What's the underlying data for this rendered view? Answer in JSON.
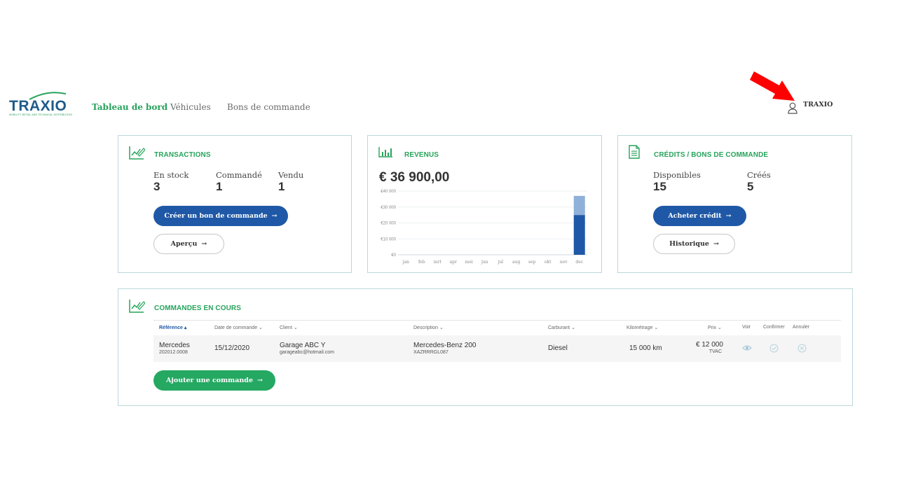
{
  "brand": {
    "name": "TRAXIO",
    "tagline": "MOBILITY RETAIL AND TECHNICAL DISTRIBUTION"
  },
  "nav": {
    "items": [
      {
        "label": "Tableau de bord",
        "active": true
      },
      {
        "label": "Véhicules",
        "active": false
      },
      {
        "label": "Bons de commande",
        "active": false
      }
    ]
  },
  "user": {
    "name": "TRAXIO",
    "icon": "user-icon",
    "annotation_color": "#ff0000"
  },
  "transactions": {
    "title": "TRANSACTIONS",
    "stats": [
      {
        "label": "En stock",
        "value": "3"
      },
      {
        "label": "Commandé",
        "value": "1"
      },
      {
        "label": "Vendu",
        "value": "1"
      }
    ],
    "primary_button": "Créer un bon de commande",
    "secondary_button": "Aperçu"
  },
  "revenue": {
    "title": "REVENUS",
    "amount": "€ 36 900,00"
  },
  "chart_data": {
    "type": "bar",
    "categories": [
      "jan",
      "feb",
      "mrt",
      "apr",
      "mei",
      "jun",
      "jul",
      "aug",
      "sep",
      "okt",
      "nov",
      "dec"
    ],
    "series": [
      {
        "values": [
          0,
          0,
          0,
          0,
          0,
          0,
          0,
          0,
          0,
          0,
          0,
          25000
        ],
        "color": "#1f58a6"
      },
      {
        "values": [
          0,
          0,
          0,
          0,
          0,
          0,
          0,
          0,
          0,
          0,
          0,
          12000
        ],
        "color": "#8fb0d8"
      }
    ],
    "ytick_labels": [
      "€0",
      "€10 000",
      "€20 000",
      "€30 000",
      "€40 000"
    ],
    "ytick_values": [
      0,
      10000,
      20000,
      30000,
      40000
    ],
    "ylim": [
      0,
      40000
    ],
    "stacked": true,
    "grid": true
  },
  "credits": {
    "title": "CRÉDITS / BONS DE COMMANDE",
    "stats": [
      {
        "label": "Disponibles",
        "value": "15"
      },
      {
        "label": "Créés",
        "value": "5"
      }
    ],
    "primary_button": "Acheter crédit",
    "secondary_button": "Historique"
  },
  "orders": {
    "title": "COMMANDES EN COURS",
    "columns": [
      "Référence",
      "Date de commande",
      "Client",
      "Description",
      "Carburant",
      "Kilométrage",
      "Prix",
      "Voir",
      "Confirmer",
      "Annuler"
    ],
    "rows": [
      {
        "reference": "Mercedes",
        "reference_sub": "202012.0008",
        "date": "15/12/2020",
        "client": "Garage ABC Y",
        "client_sub": "garageabc@hotmail.com",
        "description": "Mercedes-Benz 200",
        "description_sub": "XAZRRRGL087",
        "fuel": "Diesel",
        "mileage": "15 000 km",
        "price": "€ 12 000",
        "price_sub": "TVAC"
      }
    ],
    "add_button": "Ajouter une commande"
  },
  "colors": {
    "accent_green": "#27a35b",
    "primary_blue": "#1f58a6",
    "card_border": "#bcd7dc"
  }
}
